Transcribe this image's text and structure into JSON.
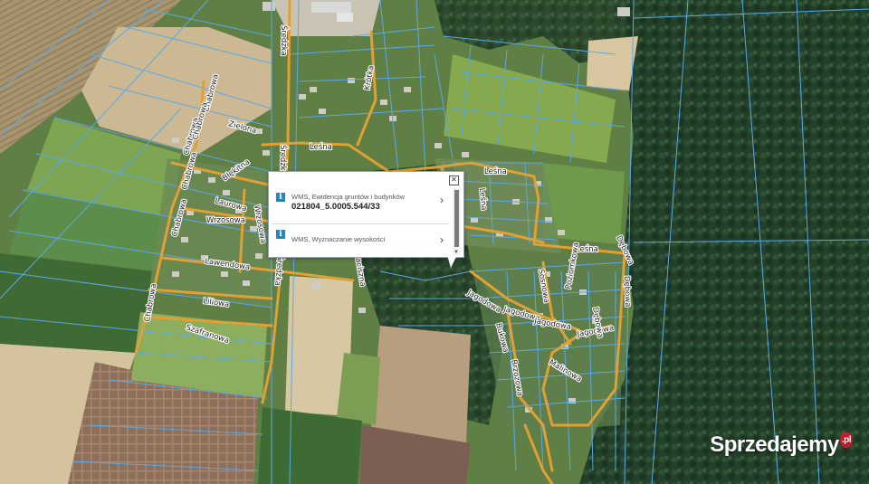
{
  "map": {
    "streets": [
      {
        "id": "sredzka-1",
        "label": "Średzka"
      },
      {
        "id": "sredzka-2",
        "label": "Średzka"
      },
      {
        "id": "sredzka-3",
        "label": "Średzka"
      },
      {
        "id": "krotka",
        "label": "Krótka"
      },
      {
        "id": "lesna-1",
        "label": "Leśna"
      },
      {
        "id": "lesna-2",
        "label": "Leśna"
      },
      {
        "id": "lesna-3",
        "label": "Leśna"
      },
      {
        "id": "lesna-4",
        "label": "Leśna"
      },
      {
        "id": "zielona",
        "label": "Zielona"
      },
      {
        "id": "chabrowa-1",
        "label": "Chabrowa"
      },
      {
        "id": "chabrowa-2",
        "label": "Chabrowa"
      },
      {
        "id": "chabrowa-3",
        "label": "Chabrowa"
      },
      {
        "id": "chabrowa-4",
        "label": "Chabrowa"
      },
      {
        "id": "chabrowa-5",
        "label": "Chabrowa"
      },
      {
        "id": "chabrowa-6",
        "label": "Chabrowa"
      },
      {
        "id": "blekitna",
        "label": "Błękitna"
      },
      {
        "id": "laurowa",
        "label": "Laurowa"
      },
      {
        "id": "wrzosowa-1",
        "label": "Wrzosowa"
      },
      {
        "id": "wrzosowa-2",
        "label": "Wrzosowa"
      },
      {
        "id": "lawendowa",
        "label": "Lawendowa"
      },
      {
        "id": "liliowa",
        "label": "Liliowa"
      },
      {
        "id": "szafranowa",
        "label": "Szafranowa"
      },
      {
        "id": "jagodowa-1",
        "label": "Jagodowa"
      },
      {
        "id": "jagodowa-2",
        "label": "Jagodowa"
      },
      {
        "id": "jagodowa-3",
        "label": "Jagodowa"
      },
      {
        "id": "jagodowa-4",
        "label": "Jagodowa"
      },
      {
        "id": "sosnowa",
        "label": "Sosnowa"
      },
      {
        "id": "debowa-1",
        "label": "Dębowa"
      },
      {
        "id": "debowa-2",
        "label": "Dębowa"
      },
      {
        "id": "malinowa",
        "label": "Malinowa"
      },
      {
        "id": "bukowa",
        "label": "Bukowa"
      },
      {
        "id": "brzozowa",
        "label": "Brzozowa"
      },
      {
        "id": "poziomkowa",
        "label": "Poziomkowa"
      },
      {
        "id": "zaciszna",
        "label": "Zaciszna"
      },
      {
        "id": "debowa-3",
        "label": "Dębowa"
      }
    ]
  },
  "popup": {
    "close_icon": "close-icon",
    "items": [
      {
        "icon": "info-icon",
        "title": "WMS, Ewidencja gruntów i budynków",
        "value": "021804_5.0005.544/33",
        "chevron": "›"
      },
      {
        "icon": "info-icon",
        "title": "WMS, Wyznaczanie wysokości",
        "value": "",
        "chevron": "›"
      }
    ],
    "scroll_down": "▼"
  },
  "watermark": {
    "text": "Sprzedajemy",
    "badge": ".pl"
  },
  "colors": {
    "road": "#e0a033",
    "parcel": "#5aa9e8",
    "forest": "#1e3a1f",
    "field": "#9a8a63",
    "meadow": "#5e8a45"
  }
}
